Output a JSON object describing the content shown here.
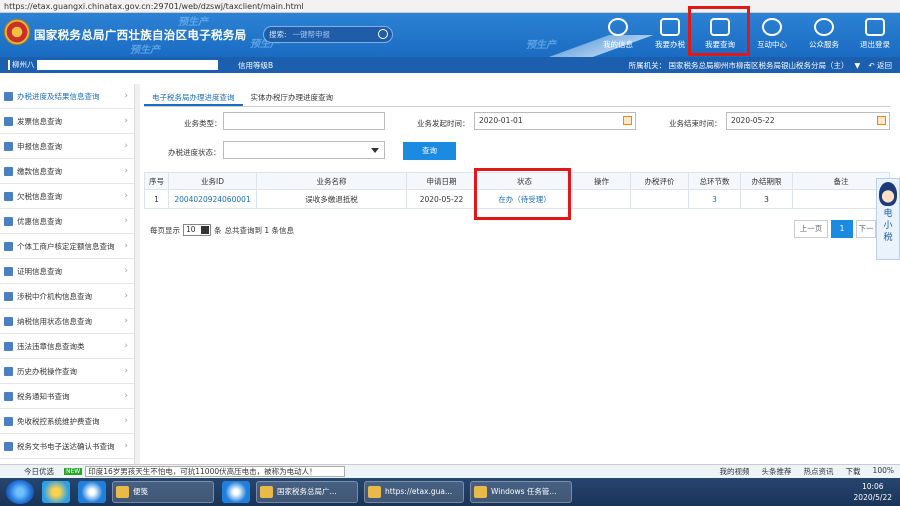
{
  "browser": {
    "url": "https://etax.guangxi.chinatax.gov.cn:29701/web/dzswj/taxclient/main.html"
  },
  "header": {
    "site_title": "国家税务总局广西壮族自治区电子税务局",
    "watermark": "预生产",
    "search_label": "搜索:",
    "search_placeholder": "一键帮申报",
    "nav": [
      {
        "label": "我的信息",
        "icon": "user-icon"
      },
      {
        "label": "我要办税",
        "icon": "monitor-icon"
      },
      {
        "label": "我要查询",
        "icon": "search-doc-icon"
      },
      {
        "label": "互动中心",
        "icon": "chat-icon"
      },
      {
        "label": "公众服务",
        "icon": "service-icon"
      },
      {
        "label": "退出登录",
        "icon": "logout-icon"
      }
    ]
  },
  "subbar": {
    "user": "柳州八",
    "credit": "信用等级B",
    "org": "所属机关：  国家税务总局柳州市柳南区税务局银山税务分局（主）",
    "return": "返回"
  },
  "sidebar": {
    "items": [
      {
        "label": "办税进度及结果信息查询",
        "active": true
      },
      {
        "label": "发票信息查询"
      },
      {
        "label": "申报信息查询"
      },
      {
        "label": "缴款信息查询"
      },
      {
        "label": "欠税信息查询"
      },
      {
        "label": "优惠信息查询"
      },
      {
        "label": "个体工商户核定定额信息查询"
      },
      {
        "label": "证明信息查询"
      },
      {
        "label": "涉税中介机构信息查询"
      },
      {
        "label": "纳税信用状态信息查询"
      },
      {
        "label": "违法违章信息查询类"
      },
      {
        "label": "历史办税操作查询"
      },
      {
        "label": "税务通知书查询"
      },
      {
        "label": "免收税控系统维护费查询"
      },
      {
        "label": "税务文书电子送达确认书查询"
      }
    ]
  },
  "tabs": [
    "电子税务局办理进度查询",
    "实体办税厅办理进度查询"
  ],
  "form": {
    "type_label": "业务类型：",
    "type_value": "",
    "start_label": "业务发起时间：",
    "start_value": "2020-01-01",
    "end_label": "业务结束时间：",
    "end_value": "2020-05-22",
    "status_label": "办税进度状态：",
    "status_value": "",
    "query_button": "查询"
  },
  "table": {
    "headers": [
      "序号",
      "业务ID",
      "业务名称",
      "申请日期",
      "状态",
      "操作",
      "办税评价",
      "总环节数",
      "办结期限",
      "备注"
    ],
    "rows": [
      [
        "1",
        "2004020924060001",
        "误收多缴退抵税",
        "2020-05-22",
        "在办（待受理）",
        "",
        "",
        "3",
        "3",
        ""
      ]
    ]
  },
  "pager": {
    "per_page_label": "每页显示",
    "per_page": "10",
    "unit": "条",
    "total": "总共查询到 1 条信息",
    "prev": "上一页",
    "current": "1",
    "next": "下一"
  },
  "assistant": {
    "label": "电小税"
  },
  "ticker": {
    "today": "今日优选",
    "badge": "NEW",
    "news": "印度16岁男孩天生不怕电，可抗11000伏高压电击，被称为电动人！",
    "video": "我的视频",
    "headline": "头条推荐",
    "hot": "热点资讯",
    "download": "下载",
    "zoom": "100%"
  },
  "taskbar": {
    "tasks": [
      "便笺",
      "国家税务总局广...",
      "https://etax.gua...",
      "Windows 任务管..."
    ],
    "time": "10:06",
    "date": "2020/5/22"
  }
}
